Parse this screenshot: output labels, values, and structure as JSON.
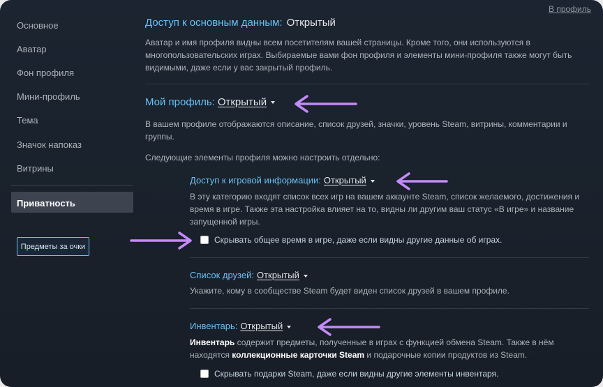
{
  "sidebar": {
    "items": [
      {
        "label": "Основное"
      },
      {
        "label": "Аватар"
      },
      {
        "label": "Фон профиля"
      },
      {
        "label": "Мини-профиль"
      },
      {
        "label": "Тема"
      },
      {
        "label": "Значок напоказ"
      },
      {
        "label": "Витрины"
      }
    ],
    "active_label": "Приватность",
    "badge_button_label": "Предметы за очки"
  },
  "header": {
    "profile_link": "В профиль"
  },
  "basic": {
    "title": "Доступ к основным данным:",
    "value": "Открытый",
    "description": "Аватар и имя профиля видны всем посетителям вашей страницы. Кроме того, они используются в многопользовательских играх. Выбираемые вами фон профиля и элементы мини-профиля также могут быть видимыми, даже если у вас закрытый профиль."
  },
  "my_profile": {
    "title": "Мой профиль:",
    "value": "Открытый",
    "description": "В вашем профиле отображаются описание, список друзей, значки, уровень Steam, витрины, комментарии и группы.",
    "note": "Следующие элементы профиля можно настроить отдельно:"
  },
  "game_details": {
    "title": "Доступ к игровой информации:",
    "value": "Открытый",
    "description": "В эту категорию входят список всех игр на вашем аккаунте Steam, список желаемого, достижения и время в игре. Также эта настройка влияет на то, видны ли другим ваш статус «В игре» и название запущенной игры.",
    "checkbox_label": "Скрывать общее время в игре, даже если видны другие данные об играх.",
    "checkbox_checked": false
  },
  "friends": {
    "title": "Список друзей:",
    "value": "Открытый",
    "description": "Укажите, кому в сообществе Steam будет виден список друзей в вашем профиле."
  },
  "inventory": {
    "title": "Инвентарь:",
    "value": "Открытый",
    "desc_strong1": "Инвентарь",
    "desc_part1": " содержит предметы, полученные в играх с функцией обмена Steam. Также в нём находятся ",
    "desc_strong2": "коллекционные карточки Steam",
    "desc_part2": " и подарочные копии продуктов из Steam.",
    "checkbox_label": "Скрывать подарки Steam, даже если видны другие элементы инвентаря.",
    "checkbox_checked": false
  },
  "colors": {
    "accent": "#67c1f5",
    "annotation_arrow": "#c58af9",
    "background": "#1b2230"
  }
}
